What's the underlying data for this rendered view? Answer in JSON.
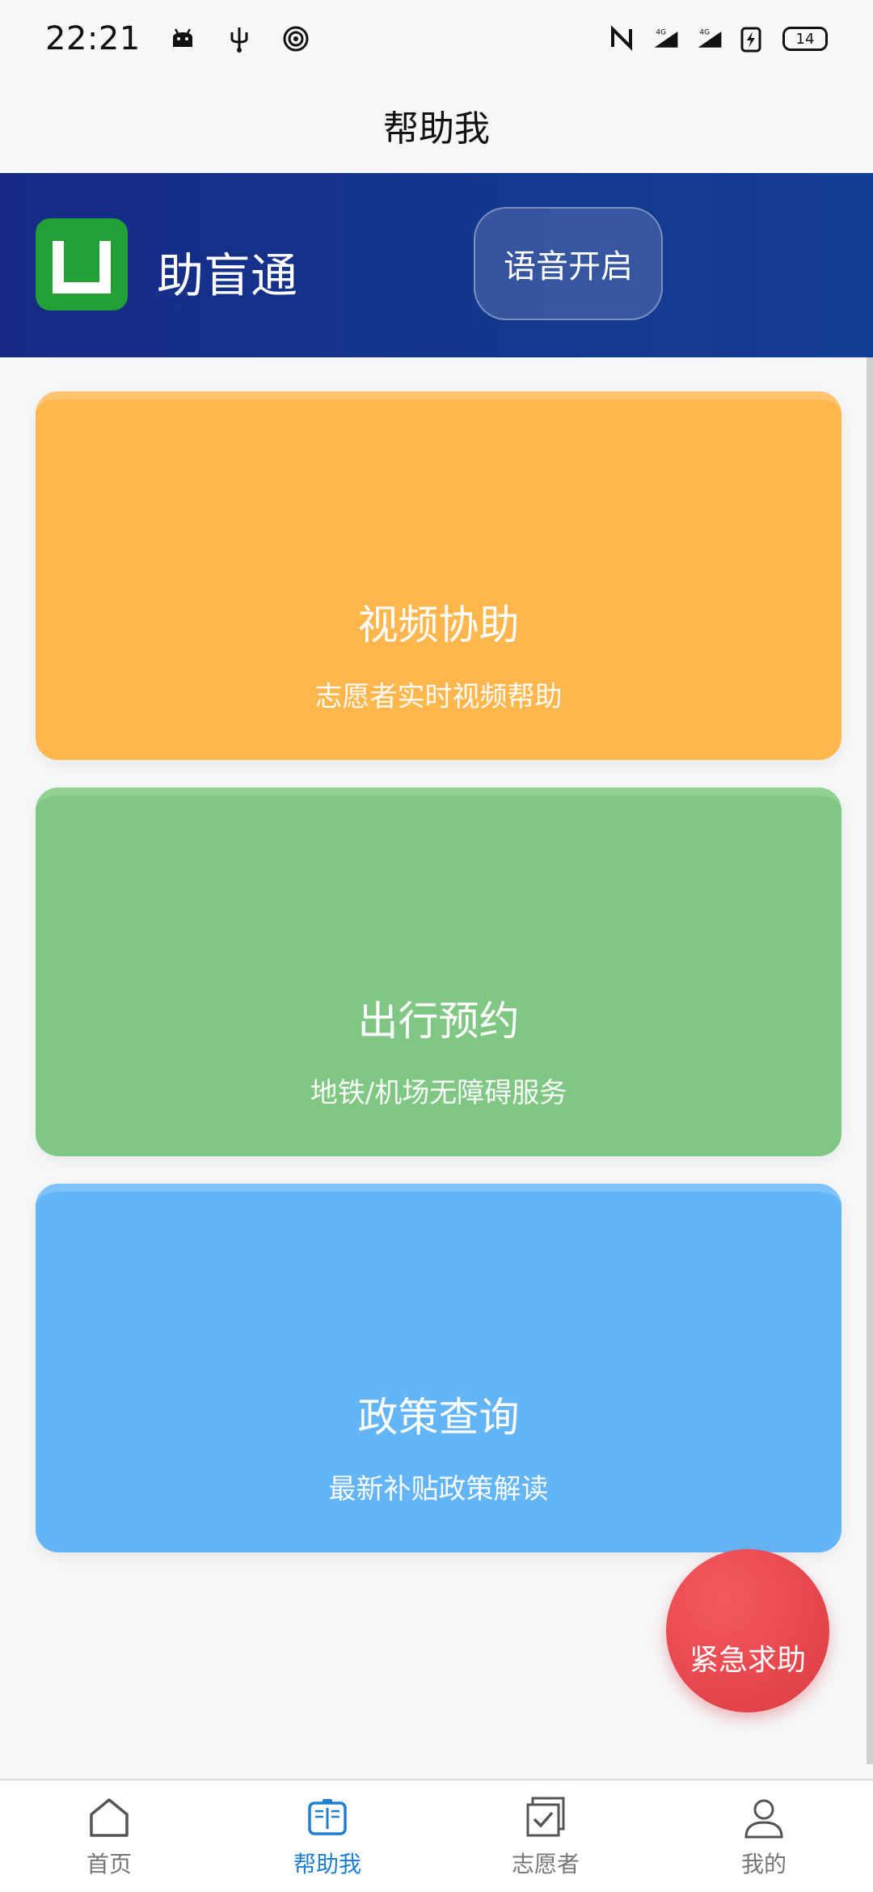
{
  "status_bar": {
    "time": "22:21",
    "left_icons": [
      "android-icon",
      "usb-icon",
      "hotspot-icon"
    ],
    "right_icons": [
      "nfc-icon",
      "signal-4g-icon",
      "signal-4g-icon",
      "battery-saver-icon"
    ],
    "battery": "14"
  },
  "app_bar": {
    "title": "帮助我"
  },
  "banner": {
    "brand": "助盲通",
    "voice_button": "语音开启",
    "colors": {
      "start": "#162a85",
      "end": "#133c95",
      "logo": "#22a035"
    }
  },
  "cards": [
    {
      "title": "视频协助",
      "subtitle": "志愿者实时视频帮助",
      "color": "#ffb74d"
    },
    {
      "title": "出行预约",
      "subtitle": "地铁/机场无障碍服务",
      "color": "#81c784"
    },
    {
      "title": "政策查询",
      "subtitle": "最新补贴政策解读",
      "color": "#64b5f6"
    }
  ],
  "sos": {
    "label": "紧急求助",
    "color": "#e8484e"
  },
  "nav": {
    "items": [
      {
        "label": "首页",
        "icon": "home-icon",
        "active": false
      },
      {
        "label": "帮助我",
        "icon": "book-icon",
        "active": true
      },
      {
        "label": "志愿者",
        "icon": "checklist-icon",
        "active": false
      },
      {
        "label": "我的",
        "icon": "user-icon",
        "active": false
      }
    ],
    "active_color": "#1e7fd1"
  }
}
